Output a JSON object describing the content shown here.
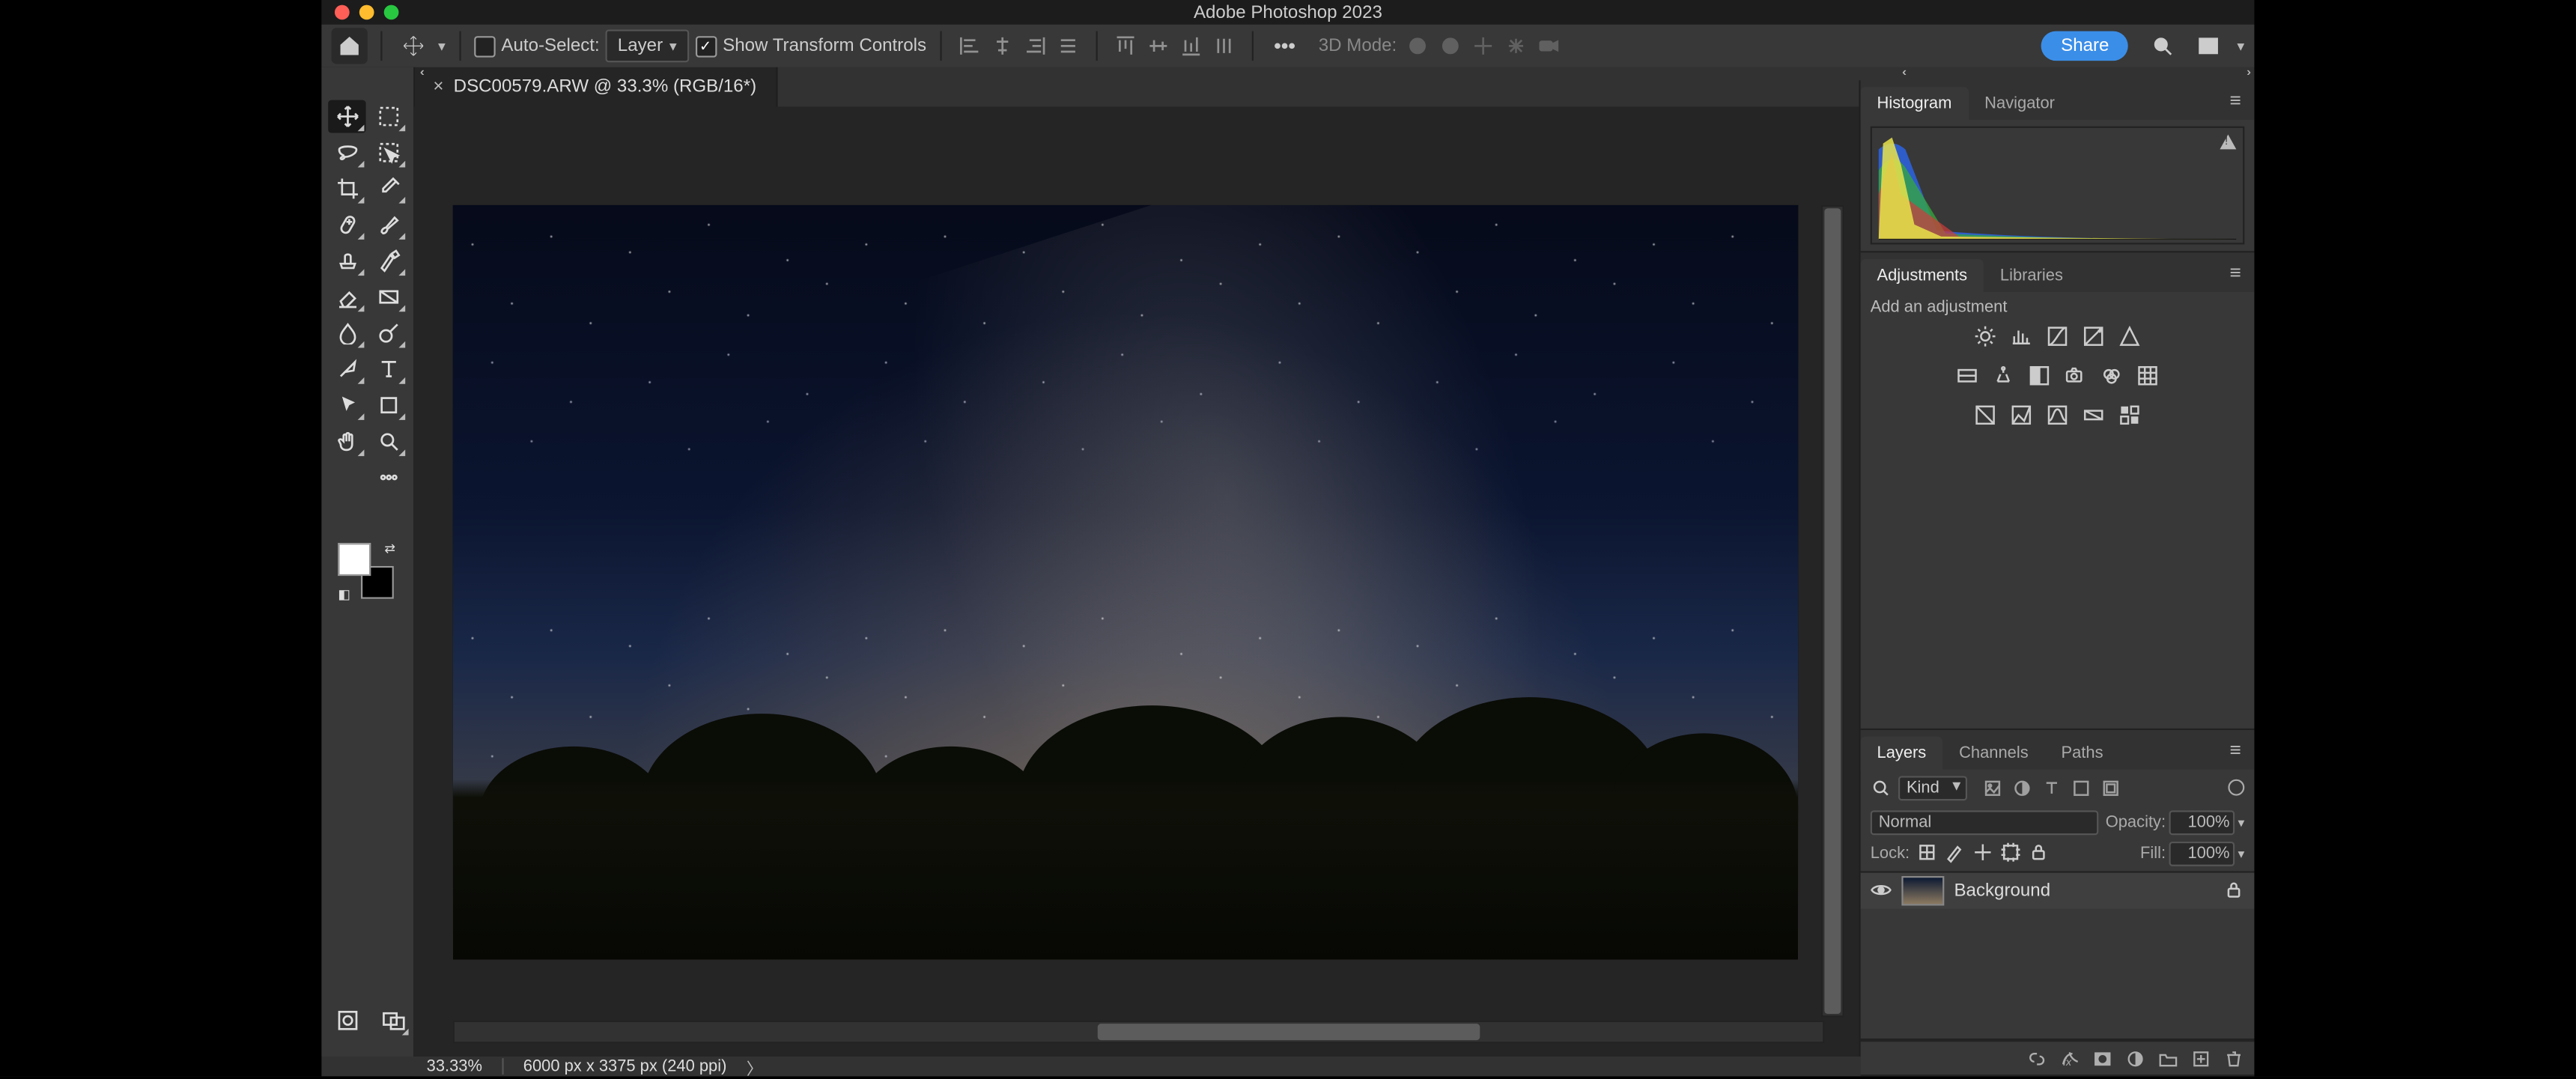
{
  "app_title": "Adobe Photoshop 2023",
  "optionsbar": {
    "auto_select_label": "Auto-Select:",
    "auto_select_value": "Layer",
    "show_transform_label": "Show Transform Controls",
    "three_d_label": "3D Mode:",
    "share_label": "Share"
  },
  "doc_tab": {
    "title": "DSC00579.ARW @ 33.3% (RGB/16*)"
  },
  "status": {
    "zoom": "33.33%",
    "dims": "6000 px x 3375 px (240 ppi)"
  },
  "panel_histogram": {
    "tabs": [
      "Histogram",
      "Navigator"
    ]
  },
  "panel_adjustments": {
    "tabs": [
      "Adjustments",
      "Libraries"
    ],
    "hint": "Add an adjustment"
  },
  "panel_layers": {
    "tabs": [
      "Layers",
      "Channels",
      "Paths"
    ],
    "filter_kind": "Kind",
    "blend_mode": "Normal",
    "opacity_label": "Opacity:",
    "opacity_value": "100%",
    "lock_label": "Lock:",
    "fill_label": "Fill:",
    "fill_value": "100%",
    "layers": [
      {
        "name": "Background",
        "locked": true,
        "visible": true
      }
    ]
  }
}
